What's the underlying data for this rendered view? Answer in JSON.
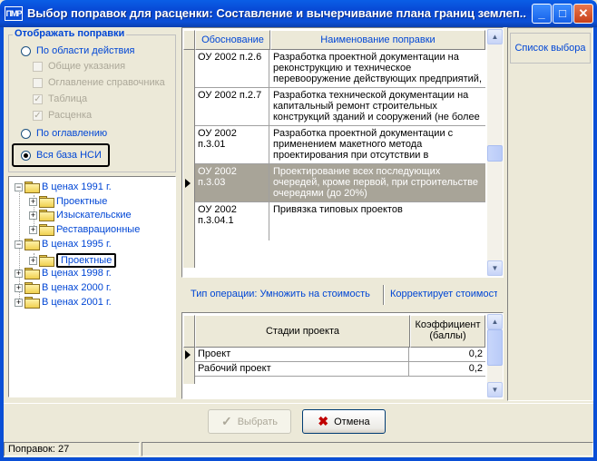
{
  "window": {
    "app_icon": "ПМР",
    "title": "Выбор поправок для расценки: Составление и вычерчивание плана границ землеп...",
    "minimize": "_",
    "maximize": "□",
    "close": "✕"
  },
  "filter_group": {
    "title": "Отображать поправки",
    "by_scope": "По области действия",
    "checks": [
      {
        "label": "Общие указания",
        "checked": false
      },
      {
        "label": "Оглавление справочника",
        "checked": false
      },
      {
        "label": "Таблица",
        "checked": true
      },
      {
        "label": "Расценка",
        "checked": true
      }
    ],
    "by_toc": "По оглавлению",
    "whole_db": "Вся база НСИ",
    "selected": "whole_db"
  },
  "tree": {
    "nodes": [
      {
        "label": "В ценах 1991 г.",
        "toggle": "−"
      },
      {
        "label": "Проектные",
        "toggle": "+"
      },
      {
        "label": "Изыскательские",
        "toggle": "+"
      },
      {
        "label": "Реставрационные",
        "toggle": "+"
      },
      {
        "label": "В ценах 1995 г.",
        "toggle": "−"
      },
      {
        "label": "Проектные",
        "toggle": "+"
      },
      {
        "label": "В ценах 1998 г.",
        "toggle": "+"
      },
      {
        "label": "В ценах 2000 г.",
        "toggle": "+"
      },
      {
        "label": "В ценах 2001 г.",
        "toggle": "+"
      }
    ]
  },
  "grid": {
    "col_code": "Обоснование",
    "col_name": "Наименование поправки",
    "rows": [
      {
        "code": "ОУ 2002 п.2.6",
        "name": "Разработка проектной документации на реконструкцию и техническое перевооружение действующих предприятий,"
      },
      {
        "code": "ОУ 2002 п.2.7",
        "name": "Разработка технической документации на капитальный ремонт строительных конструкций зданий и сооружений (не более"
      },
      {
        "code": "ОУ 2002 п.3.01",
        "name": "Разработка проектной документации с применением макетного метода проектирования при отсутствии в"
      },
      {
        "code": "ОУ 2002 п.3.03",
        "name": "Проектирование всех последующих очередей, кроме первой, при строительстве очередями (до 20%)"
      },
      {
        "code": "ОУ 2002 п.3.04.1",
        "name": "Привязка типовых проектов"
      }
    ]
  },
  "side": {
    "list_button": "Список выбора"
  },
  "operation": {
    "type": "Тип операции: Умножить на стоимость",
    "corrects": "Корректирует стоимость"
  },
  "stages": {
    "col_stage": "Стадии проекта",
    "col_coef": "Коэффициент (баллы)",
    "rows": [
      {
        "stage": "Проект",
        "coef": "0,2"
      },
      {
        "stage": "Рабочий проект",
        "coef": "0,2"
      }
    ]
  },
  "buttons": {
    "select": "Выбрать",
    "cancel": "Отмена"
  },
  "status": {
    "count": "Поправок: 27"
  },
  "icons": {
    "select": "check-icon",
    "cancel": "x-icon"
  }
}
